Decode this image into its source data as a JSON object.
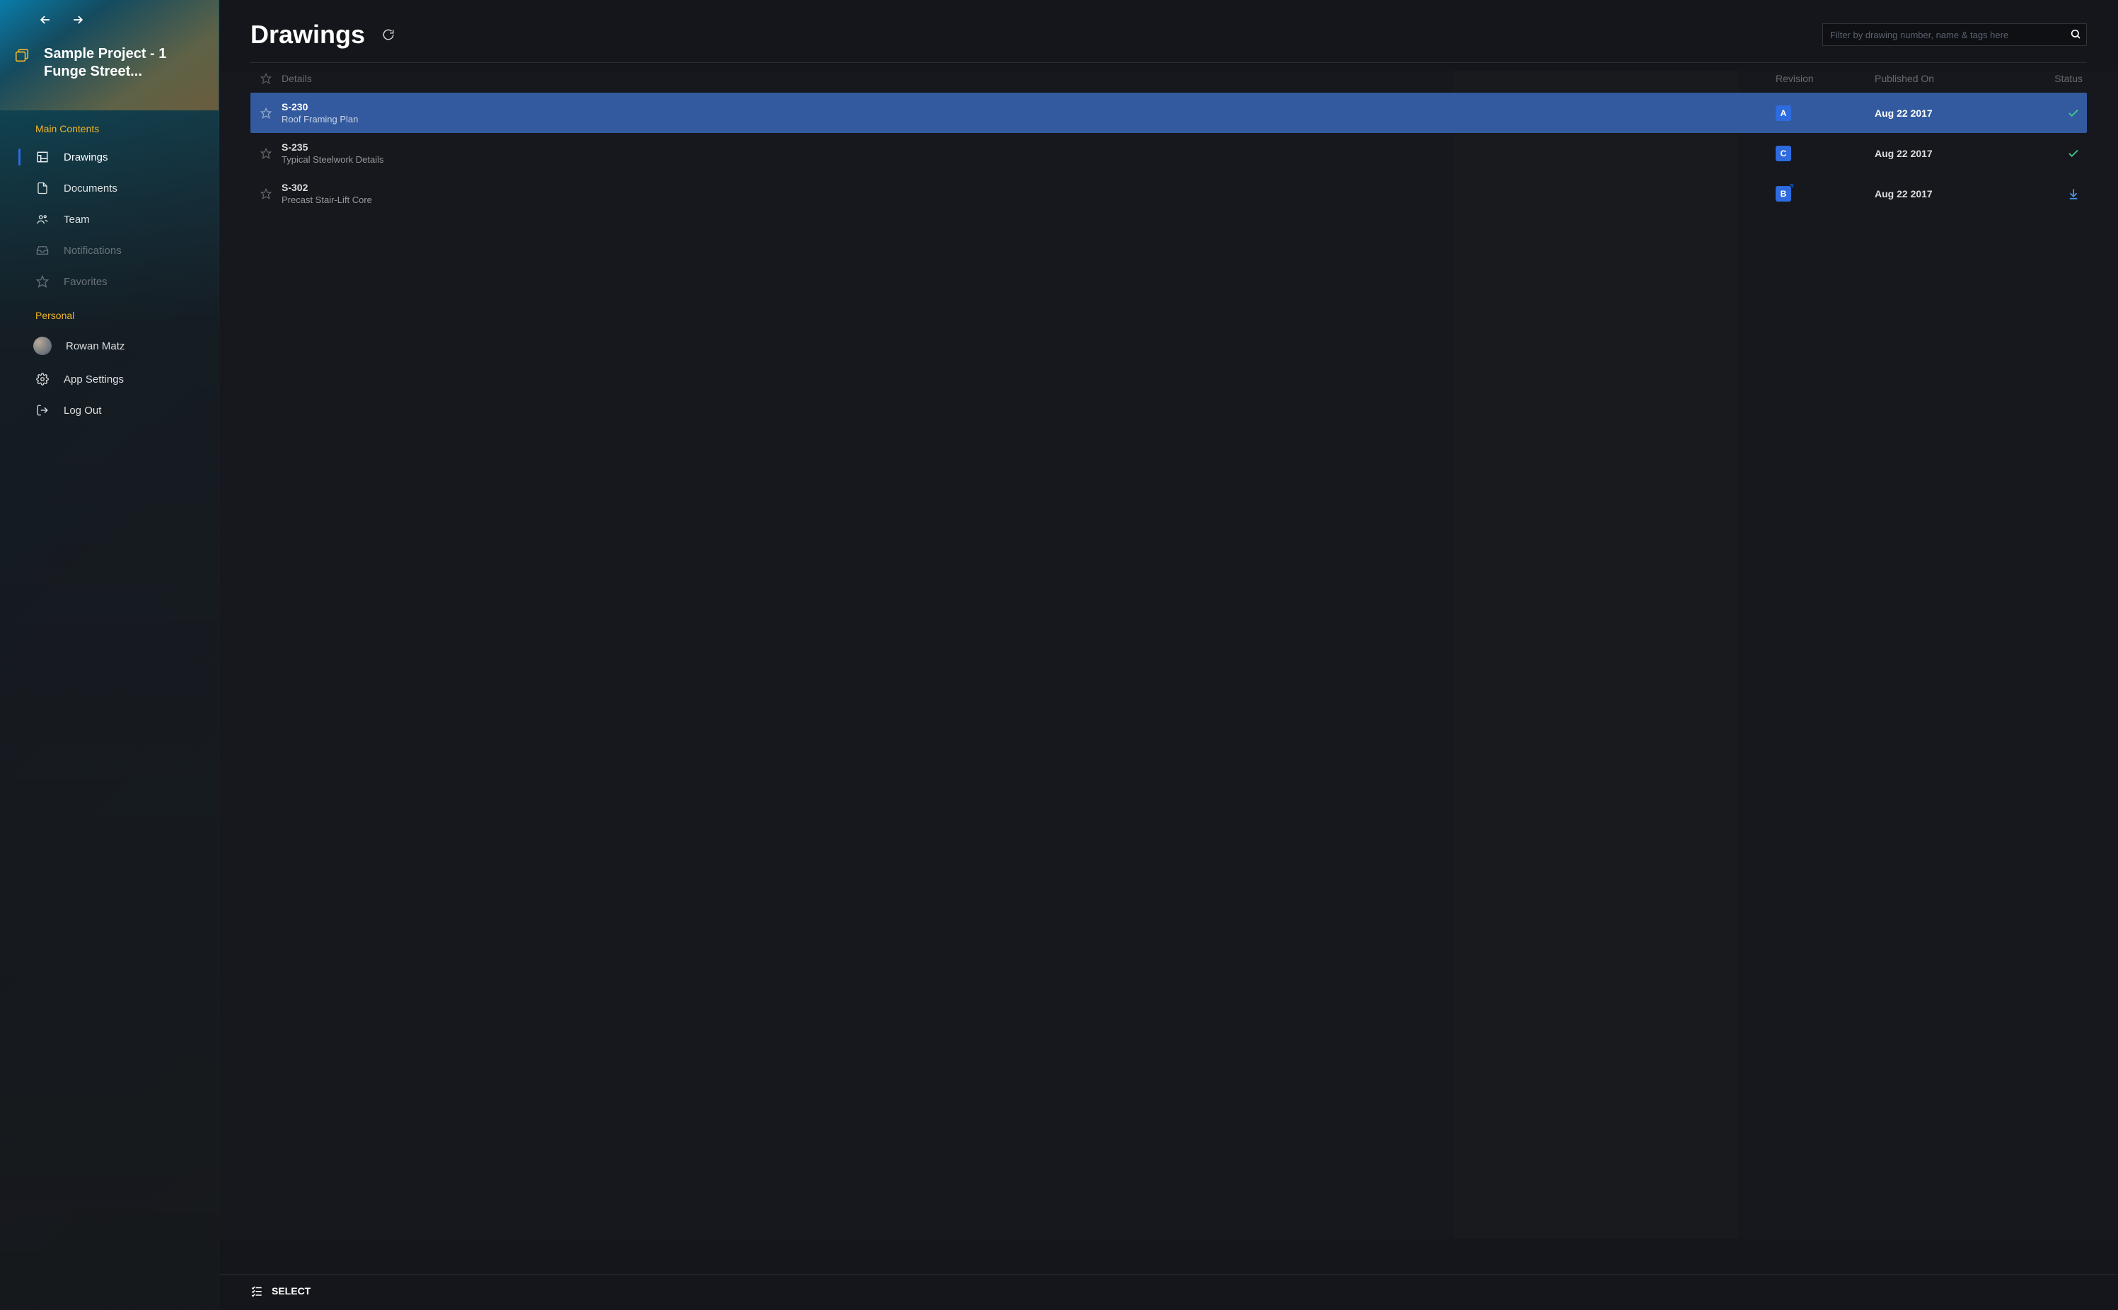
{
  "sidebar": {
    "project_title": "Sample Project - 1 Funge Street...",
    "sections": {
      "main_label": "Main Contents",
      "personal_label": "Personal"
    },
    "items": {
      "drawings": "Drawings",
      "documents": "Documents",
      "team": "Team",
      "notifications": "Notifications",
      "favorites": "Favorites"
    },
    "personal": {
      "user": "Rowan Matz",
      "settings": "App Settings",
      "logout": "Log Out"
    }
  },
  "header": {
    "title": "Drawings",
    "search_placeholder": "Filter by drawing number, name & tags here"
  },
  "columns": {
    "details": "Details",
    "revision": "Revision",
    "published": "Published On",
    "status": "Status"
  },
  "rows": [
    {
      "number": "S-230",
      "name": "Roof Framing Plan",
      "rev": "A",
      "published": "Aug 22 2017",
      "status": "ok",
      "selected": true
    },
    {
      "number": "S-235",
      "name": "Typical Steelwork Details",
      "rev": "C",
      "published": "Aug 22 2017",
      "status": "ok",
      "selected": false
    },
    {
      "number": "S-302",
      "name": "Precast Stair-Lift Core",
      "rev": "B",
      "published": "Aug 22 2017",
      "status": "down",
      "selected": false
    }
  ],
  "footer": {
    "select": "SELECT"
  }
}
